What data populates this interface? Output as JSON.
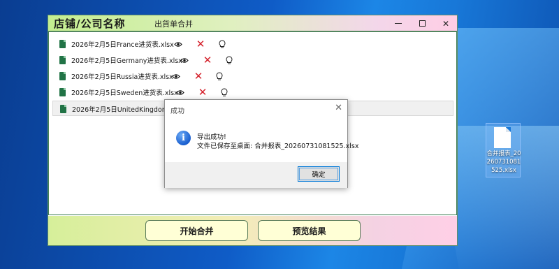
{
  "app": {
    "title": "店铺/公司名称",
    "menu_label": "出貨单合并",
    "window_controls": [
      "minimize-icon",
      "maximize-icon",
      "close-icon"
    ]
  },
  "file_list": [
    {
      "name": "2026年2月5日France进货表.xlsx",
      "selected": false
    },
    {
      "name": "2026年2月5日Germany进货表.xlsx",
      "selected": false
    },
    {
      "name": "2026年2月5日Russia进货表.xlsx",
      "selected": false
    },
    {
      "name": "2026年2月5日Sweden进货表.xlsx",
      "selected": false
    },
    {
      "name": "2026年2月5日UnitedKingdom进货表.xlsx",
      "selected": true
    }
  ],
  "row_icons": [
    "eye-icon",
    "x-icon",
    "lightbulb-icon"
  ],
  "buttons": {
    "merge": "开始合并",
    "preview": "预览结果"
  },
  "dialog": {
    "title": "成功",
    "message_line1": "导出成功!",
    "message_line2": "文件已保存至桌面: 合并报表_20260731081525.xlsx",
    "ok_label": "确定",
    "icon": "info-icon"
  },
  "desktop_file": {
    "label": "合并报表_20260731081525.xlsx",
    "icon": "document-icon"
  },
  "colors": {
    "delete_red": "#d4202a",
    "excel_green": "#217346",
    "button_fill": "#ffffd6"
  }
}
